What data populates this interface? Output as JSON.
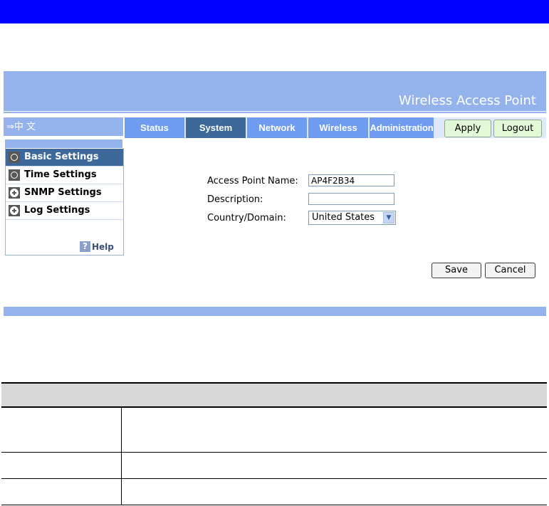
{
  "header": {
    "title": "Wireless Access Point"
  },
  "language_link": "⇒中 文",
  "nav": {
    "tabs": [
      {
        "label": "Status"
      },
      {
        "label": "System"
      },
      {
        "label": "Network"
      },
      {
        "label": "Wireless"
      },
      {
        "label": "Administration"
      }
    ],
    "active_tab": "System",
    "apply_label": "Apply",
    "logout_label": "Logout"
  },
  "sidebar": {
    "items": [
      {
        "label": "Basic Settings",
        "icon": "circle-icon"
      },
      {
        "label": "Time Settings",
        "icon": "circle-icon"
      },
      {
        "label": "SNMP Settings",
        "icon": "plus-icon"
      },
      {
        "label": "Log Settings",
        "icon": "plus-icon"
      }
    ],
    "help_label": "Help"
  },
  "form": {
    "ap_name_label": "Access Point Name:",
    "ap_name_value": "AP4F2B34",
    "description_label": "Description:",
    "description_value": "",
    "country_label": "Country/Domain:",
    "country_value": "United States",
    "save_label": "Save",
    "cancel_label": "Cancel"
  },
  "colors": {
    "top_bar": "#0000ff",
    "header_blue": "#94b2ec",
    "tab_blue": "#6f9cf0",
    "tab_active": "#3c689a",
    "button_green": "#e3f8d7"
  }
}
